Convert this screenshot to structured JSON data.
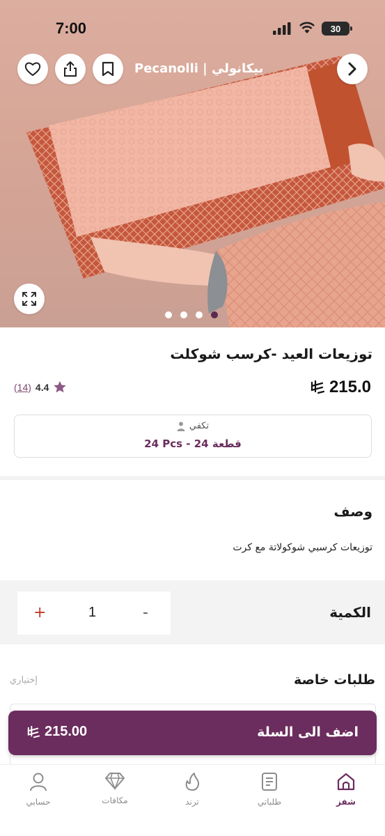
{
  "status_bar": {
    "time": "7:00",
    "battery": "30"
  },
  "header": {
    "store_name": "Pecanolli | بيكانولي"
  },
  "carousel": {
    "pages": 4,
    "active_page": 4
  },
  "product": {
    "title": "توزيعات العيد -كرسب شوكلت",
    "price": "215.0",
    "rating": "4.4",
    "rating_count": "(14)",
    "serves_label": "تكفي",
    "serves_value": "24 Pcs - 24 قطعة"
  },
  "description": {
    "heading": "وصف",
    "body": "توزيعات كرسبي شوكولاتة مع كرت"
  },
  "quantity": {
    "label": "الكمية",
    "value": "1",
    "plus": "+",
    "minus": "-"
  },
  "special_requests": {
    "label": "طلبات خاصة",
    "optional": "إختياري"
  },
  "cart_button": {
    "label": "اضف الى السلة",
    "price": "215.00"
  },
  "tabbar": {
    "items": [
      {
        "label": "شفز",
        "icon": "home-icon",
        "active": true
      },
      {
        "label": "طلباتي",
        "icon": "orders-icon",
        "active": false
      },
      {
        "label": "ترند",
        "icon": "trend-icon",
        "active": false
      },
      {
        "label": "مكافات",
        "icon": "rewards-icon",
        "active": false
      },
      {
        "label": "حسابي",
        "icon": "account-icon",
        "active": false
      }
    ]
  },
  "colors": {
    "accent": "#6b2c5e",
    "plus": "#c0392b",
    "star": "#8e5a85"
  }
}
